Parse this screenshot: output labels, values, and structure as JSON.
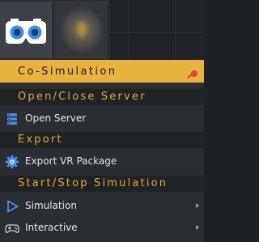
{
  "toolbar": {
    "buttons": [
      {
        "icon": "vr-headset-icon"
      },
      {
        "icon": "blurred-scene-icon"
      }
    ]
  },
  "menu": {
    "title": "Co-Simulation",
    "pin_icon": "pin-icon",
    "sections": [
      {
        "label": "Open/Close Server"
      },
      {
        "label": "Export"
      },
      {
        "label": "Start/Stop Simulation"
      }
    ],
    "items": [
      {
        "label": "Open Server",
        "icon": "server-icon"
      },
      {
        "label": "Export VR Package",
        "icon": "gear-icon"
      },
      {
        "label": "Simulation",
        "icon": "play-icon",
        "has_submenu": true
      },
      {
        "label": "Interactive",
        "icon": "gamepad-icon",
        "has_submenu": true
      }
    ]
  },
  "colors": {
    "accent": "#e7b23e",
    "section_text": "#e1a93f",
    "menu_bg": "#2a2d31",
    "section_bg": "#202326",
    "icon_blue": "#4a8fe7"
  }
}
